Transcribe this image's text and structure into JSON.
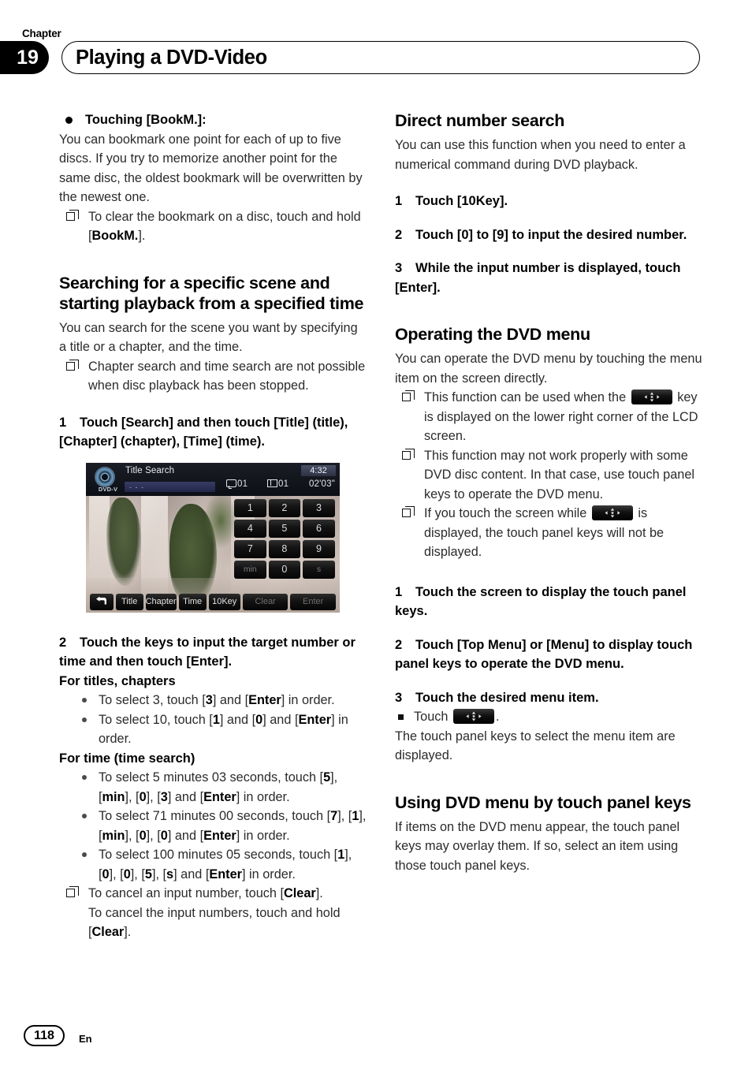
{
  "header": {
    "chapter_word": "Chapter",
    "chapter_number": "19",
    "title": "Playing a DVD-Video"
  },
  "left_column": {
    "bullet_heading": "Touching [BookM.]:",
    "bullet_body": "You can bookmark one point for each of up to five discs. If you try to memorize another point for the same disc, the oldest bookmark will be overwritten by the newest one.",
    "note_1_pre": "To clear the bookmark on a disc, touch and hold [",
    "note_1_bold": "BookM.",
    "note_1_post": "].",
    "section_heading": "Searching for a specific scene and starting playback from a specified time",
    "section_body": "You can search for the scene you want by specifying a title or a chapter, and the time.",
    "note_2": "Chapter search and time search are not possible when disc playback has been stopped.",
    "step1_num": "1",
    "step1_text": "Touch [Search] and then touch [Title] (title), [Chapter] (chapter), [Time] (time).",
    "step2_num": "2",
    "step2_text": "Touch the keys to input the target number or time and then touch [Enter].",
    "subhead_titles": "For titles, chapters",
    "bullets_titles": [
      {
        "pre": "To select 3, touch [",
        "b1": "3",
        "mid1": "] and [",
        "b2": "Enter",
        "post": "] in order."
      },
      {
        "pre": "To select 10, touch [",
        "b1": "1",
        "mid1": "] and [",
        "b2": "0",
        "mid2": "] and [",
        "b3": "Enter",
        "post": "] in order."
      }
    ],
    "subhead_time": "For time (time search)",
    "bullets_time": [
      "To select 5 minutes 03 seconds, touch [5], [min], [0], [3] and [Enter] in order.",
      "To select 71 minutes 00 seconds, touch [7], [1], [min], [0], [0] and [Enter] in order.",
      "To select 100 minutes 05 seconds, touch [1], [0], [0], [5], [s] and [Enter] in order."
    ],
    "note_3_line1_pre": "To cancel an input number, touch [",
    "note_3_line1_bold": "Clear",
    "note_3_line1_post": "].",
    "note_3_line2": "To cancel the input numbers, touch and hold [",
    "note_3_line2_bold": "Clear",
    "note_3_line2_post": "]."
  },
  "device_screenshot": {
    "disc_label": "DVD-V",
    "title": "Title Search",
    "search_field_value": "- - -",
    "clock": "4:32",
    "title_number": "01",
    "chapter_number": "01",
    "elapsed_time": "02'03\"",
    "keypad": [
      [
        "1",
        "2",
        "3"
      ],
      [
        "4",
        "5",
        "6"
      ],
      [
        "7",
        "8",
        "9"
      ],
      [
        "min",
        "0",
        "s"
      ]
    ],
    "bottom_buttons": [
      "back-icon",
      "Title",
      "Chapter",
      "Time",
      "10Key",
      "Clear",
      "Enter"
    ]
  },
  "right_column": {
    "heading_direct": "Direct number search",
    "body_direct": "You can use this function when you need to enter a numerical command during DVD playback.",
    "step1_num": "1",
    "step1_text": "Touch [10Key].",
    "step2_num": "2",
    "step2_text": "Touch [0] to [9] to input the desired number.",
    "step3_num": "3",
    "step3_text": "While the input number is displayed, touch [Enter].",
    "heading_operating": "Operating the DVD menu",
    "body_operating": "You can operate the DVD menu by touching the menu item on the screen directly.",
    "note_1_pre": "This function can be used when the",
    "note_1_post": "key is displayed on the lower right corner of the LCD screen.",
    "note_2": "This function may not work properly with some DVD disc content. In that case, use touch panel keys to operate the DVD menu.",
    "note_3_pre": "If you touch the screen while",
    "note_3_post": "is displayed, the touch panel keys will not be displayed.",
    "step_a_num": "1",
    "step_a_text": "Touch the screen to display the touch panel keys.",
    "step_b_num": "2",
    "step_b_text": "Touch [Top Menu] or [Menu] to display touch panel keys to operate the DVD menu.",
    "step_c_num": "3",
    "step_c_text": "Touch the desired menu item.",
    "sub_touch": "Touch",
    "sub_touch_post": ".",
    "sub_result": "The touch panel keys to select the menu item are displayed.",
    "heading_using": "Using DVD menu by touch panel keys",
    "body_using": "If items on the DVD menu appear, the touch panel keys may overlay them. If so, select an item using those touch panel keys."
  },
  "footer": {
    "page_number": "118",
    "language": "En"
  },
  "icons": {
    "dpad": "dpad-key-icon",
    "back": "back-arrow-icon"
  }
}
